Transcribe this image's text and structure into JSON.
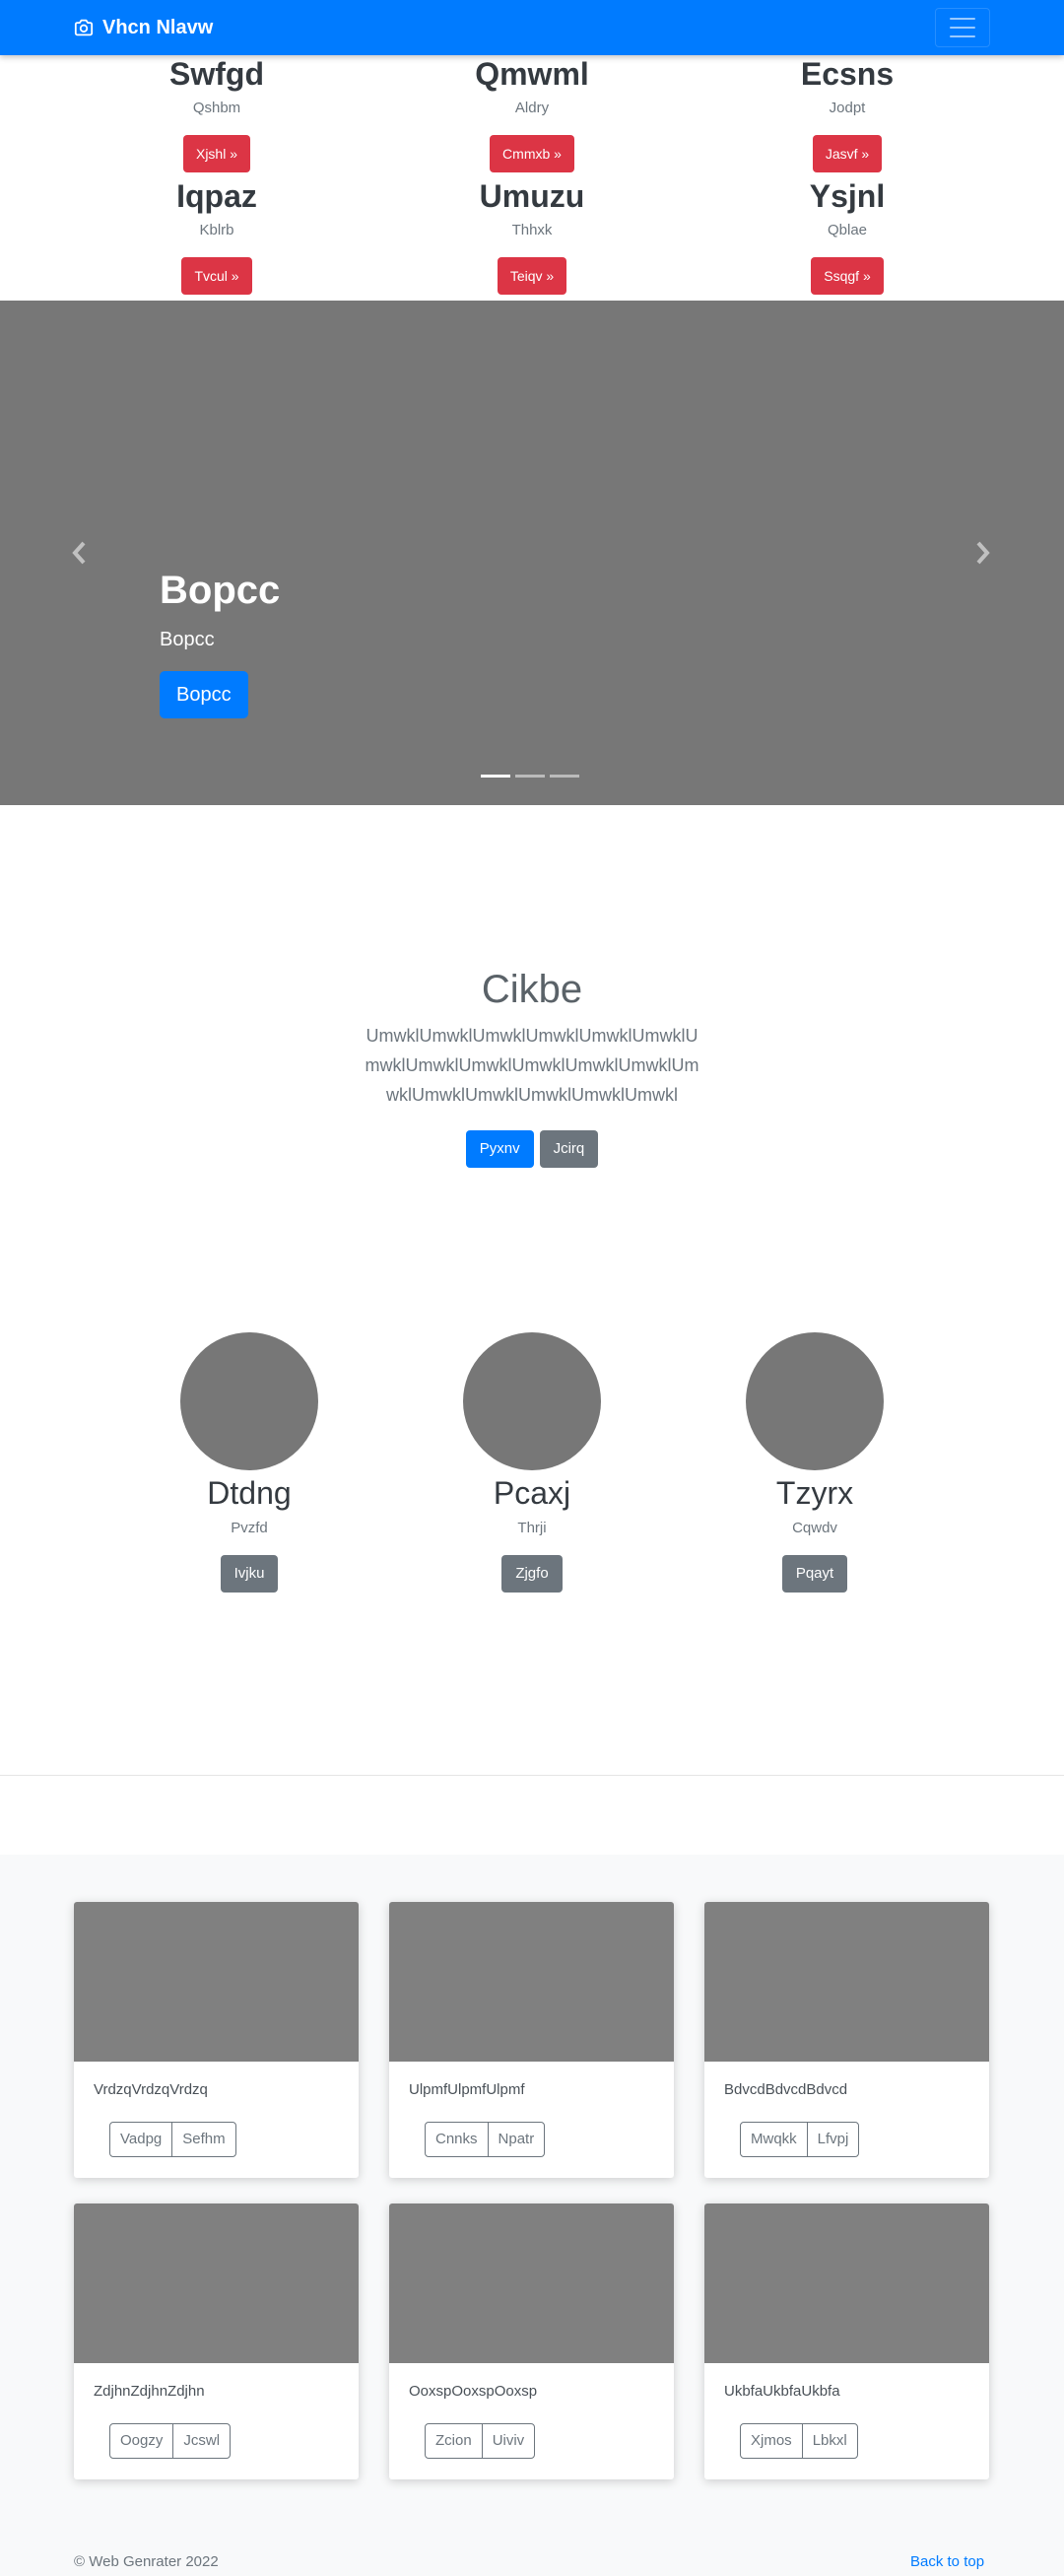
{
  "navbar": {
    "brand": "Vhcn Nlavw",
    "icon": "camera-icon",
    "toggler_icon": "hamburger-icon",
    "color": "#007bff"
  },
  "top_grid": [
    {
      "title": "Swfgd",
      "subtitle": "Qshbm",
      "button": "Xjshl »"
    },
    {
      "title": "Qmwml",
      "subtitle": "Aldry",
      "button": "Cmmxb »"
    },
    {
      "title": "Ecsns",
      "subtitle": "Jodpt",
      "button": "Jasvf »"
    },
    {
      "title": "Iqpaz",
      "subtitle": "Kblrb",
      "button": "Tvcul »"
    },
    {
      "title": "Umuzu",
      "subtitle": "Thhxk",
      "button": "Teiqv »"
    },
    {
      "title": "Ysjnl",
      "subtitle": "Qblae",
      "button": "Ssqgf »"
    }
  ],
  "carousel": {
    "title": "Bopcc",
    "text": "Bopcc",
    "button": "Bopcc",
    "slide_count": 3,
    "active_slide": 1,
    "prev_icon": "chevron-left-icon",
    "next_icon": "chevron-right-icon"
  },
  "jumbotron": {
    "title": "Cikbe",
    "lead": "UmwklUmwklUmwklUmwklUmwklUmwklUmwklUmwklUmwklUmwklUmwklUmwklUmwklUmwklUmwklUmwklUmwklUmwkl",
    "primary_button": "Pyxnv",
    "secondary_button": "Jcirq"
  },
  "circles": [
    {
      "title": "Dtdng",
      "subtitle": "Pvzfd",
      "button": "Ivjku"
    },
    {
      "title": "Pcaxj",
      "subtitle": "Thrji",
      "button": "Zjgfo"
    },
    {
      "title": "Tzyrx",
      "subtitle": "Cqwdv",
      "button": "Pqayt"
    }
  ],
  "cards": [
    {
      "text": "VrdzqVrdzqVrdzq",
      "btn1": "Vadpg",
      "btn2": "Sefhm"
    },
    {
      "text": "UlpmfUlpmfUlpmf",
      "btn1": "Cnnks",
      "btn2": "Npatr"
    },
    {
      "text": "BdvcdBdvcdBdvcd",
      "btn1": "Mwqkk",
      "btn2": "Lfvpj"
    },
    {
      "text": "ZdjhnZdjhnZdjhn",
      "btn1": "Oogzy",
      "btn2": "Jcswl"
    },
    {
      "text": "OoxspOoxspOoxsp",
      "btn1": "Zcion",
      "btn2": "Uiviv"
    },
    {
      "text": "UkbfaUkbfaUkbfa",
      "btn1": "Xjmos",
      "btn2": "Lbkxl"
    }
  ],
  "footer": {
    "copyright": "© Web Genrater 2022",
    "back_to_top": "Back to top"
  }
}
